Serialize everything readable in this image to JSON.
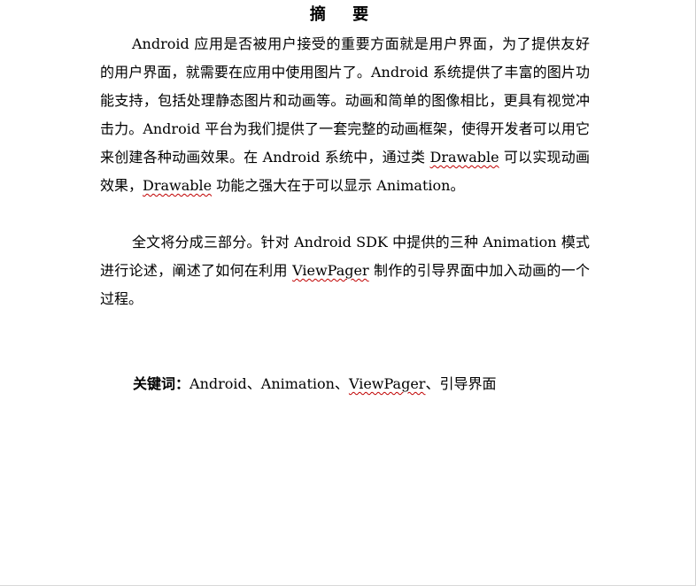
{
  "document": {
    "title": "摘 要",
    "paragraph1": {
      "part1": "Android 应用是否被用户接受的重要方面就是用户界面，为了提供友好的用户界面，就需要在应用中使用图片了。Android 系统提供了丰富的图片功能支持，包括处理静态图片和动画等。动画和简单的图像相比，更具有视觉冲击力。Android 平台为我们提供了一套完整的动画框架，使得开发者可以用它来创建各种动画效果。在 Android 系统中，通过类 ",
      "drawable1": "Drawable",
      "part2": " 可以实现动画效果，",
      "drawable2": "Drawable",
      "part3": " 功能之强大在于可以显示 Animation。"
    },
    "paragraph2": {
      "part1": "全文将分成三部分。针对 Android SDK 中提供的三种 Animation 模式进行论述，阐述了如何在利用 ",
      "viewpager": "ViewPager",
      "part2": " 制作的引导界面中加入动画的一个过程。"
    },
    "keywords": {
      "label": "关键词：",
      "k1": "Android、Animation、",
      "k2": "ViewPager",
      "k3": "、引导界面"
    }
  }
}
